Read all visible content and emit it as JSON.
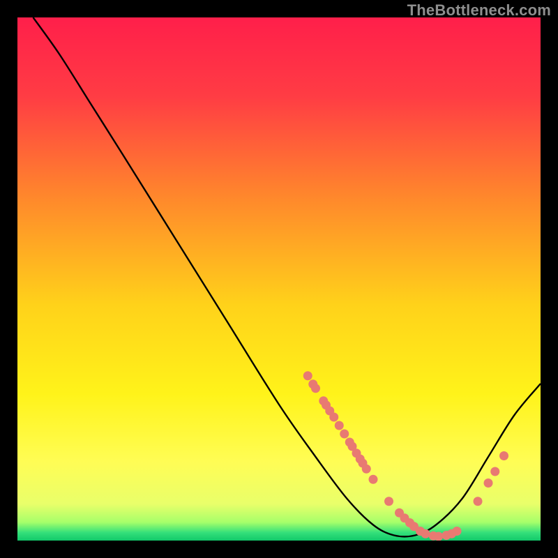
{
  "watermark": "TheBottleneck.com",
  "chart_data": {
    "type": "line",
    "title": "",
    "xlabel": "",
    "ylabel": "",
    "xlim": [
      0,
      100
    ],
    "ylim": [
      0,
      100
    ],
    "curve": [
      {
        "x": 3,
        "y": 100
      },
      {
        "x": 8,
        "y": 93
      },
      {
        "x": 14,
        "y": 83.5
      },
      {
        "x": 20,
        "y": 74
      },
      {
        "x": 30,
        "y": 58
      },
      {
        "x": 40,
        "y": 42
      },
      {
        "x": 50,
        "y": 26
      },
      {
        "x": 57,
        "y": 16
      },
      {
        "x": 63,
        "y": 8
      },
      {
        "x": 68,
        "y": 3
      },
      {
        "x": 72,
        "y": 1
      },
      {
        "x": 76,
        "y": 1
      },
      {
        "x": 80,
        "y": 3
      },
      {
        "x": 85,
        "y": 8
      },
      {
        "x": 90,
        "y": 16
      },
      {
        "x": 95,
        "y": 24
      },
      {
        "x": 100,
        "y": 30
      }
    ],
    "highlight_points": [
      {
        "x": 55.5,
        "y": 31.5
      },
      {
        "x": 56.5,
        "y": 29.9
      },
      {
        "x": 57,
        "y": 29.1
      },
      {
        "x": 58.5,
        "y": 26.7
      },
      {
        "x": 59,
        "y": 25.9
      },
      {
        "x": 59.7,
        "y": 24.8
      },
      {
        "x": 60.5,
        "y": 23.6
      },
      {
        "x": 61.5,
        "y": 22
      },
      {
        "x": 62.5,
        "y": 20.4
      },
      {
        "x": 63.5,
        "y": 18.8
      },
      {
        "x": 64,
        "y": 18
      },
      {
        "x": 64.8,
        "y": 16.7
      },
      {
        "x": 65.5,
        "y": 15.6
      },
      {
        "x": 66,
        "y": 14.8
      },
      {
        "x": 66.7,
        "y": 13.7
      },
      {
        "x": 68,
        "y": 11.7
      },
      {
        "x": 71,
        "y": 7.5
      },
      {
        "x": 73,
        "y": 5.3
      },
      {
        "x": 74,
        "y": 4.3
      },
      {
        "x": 75,
        "y": 3.4
      },
      {
        "x": 75.8,
        "y": 2.7
      },
      {
        "x": 77,
        "y": 1.8
      },
      {
        "x": 78,
        "y": 1.3
      },
      {
        "x": 79.5,
        "y": 0.9
      },
      {
        "x": 80.5,
        "y": 0.8
      },
      {
        "x": 82,
        "y": 1.0
      },
      {
        "x": 83,
        "y": 1.3
      },
      {
        "x": 84,
        "y": 1.8
      },
      {
        "x": 88,
        "y": 7.5
      },
      {
        "x": 90,
        "y": 11
      },
      {
        "x": 91.3,
        "y": 13.2
      },
      {
        "x": 93,
        "y": 16.2
      }
    ],
    "gradient_stops": [
      {
        "offset": 0.0,
        "color": "#ff1f4a"
      },
      {
        "offset": 0.15,
        "color": "#ff3c44"
      },
      {
        "offset": 0.35,
        "color": "#ff8a2b"
      },
      {
        "offset": 0.55,
        "color": "#ffd21a"
      },
      {
        "offset": 0.72,
        "color": "#fff31a"
      },
      {
        "offset": 0.85,
        "color": "#fffd55"
      },
      {
        "offset": 0.93,
        "color": "#e9ff6a"
      },
      {
        "offset": 0.965,
        "color": "#a6ff6a"
      },
      {
        "offset": 0.985,
        "color": "#33e07a"
      },
      {
        "offset": 1.0,
        "color": "#12c86a"
      }
    ],
    "point_color": "#e87a72",
    "curve_color": "#000000"
  }
}
